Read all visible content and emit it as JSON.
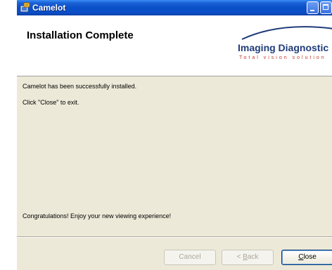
{
  "window": {
    "title": "Camelot",
    "accent": "#0a4ec8",
    "background": "#ece9d8"
  },
  "banner": {
    "title": "Installation Complete",
    "logo_name": "Imaging Diagnostic",
    "logo_tagline": "Total vision solution",
    "logo_color": "#1f3b7a",
    "tagline_color": "#c0392b"
  },
  "content": {
    "line1": "Camelot has been successfully installed.",
    "line2": "Click \"Close\" to exit.",
    "line3": "Congratulations! Enjoy your new viewing experience!"
  },
  "buttons": {
    "cancel": "Cancel",
    "back_prefix": "< ",
    "back_mnemonic": "B",
    "back_rest": "ack",
    "close_mnemonic": "C",
    "close_rest": "lose"
  },
  "icons": {
    "app": "installer-icon",
    "minimize": "minimize-icon",
    "maximize": "maximize-icon"
  }
}
